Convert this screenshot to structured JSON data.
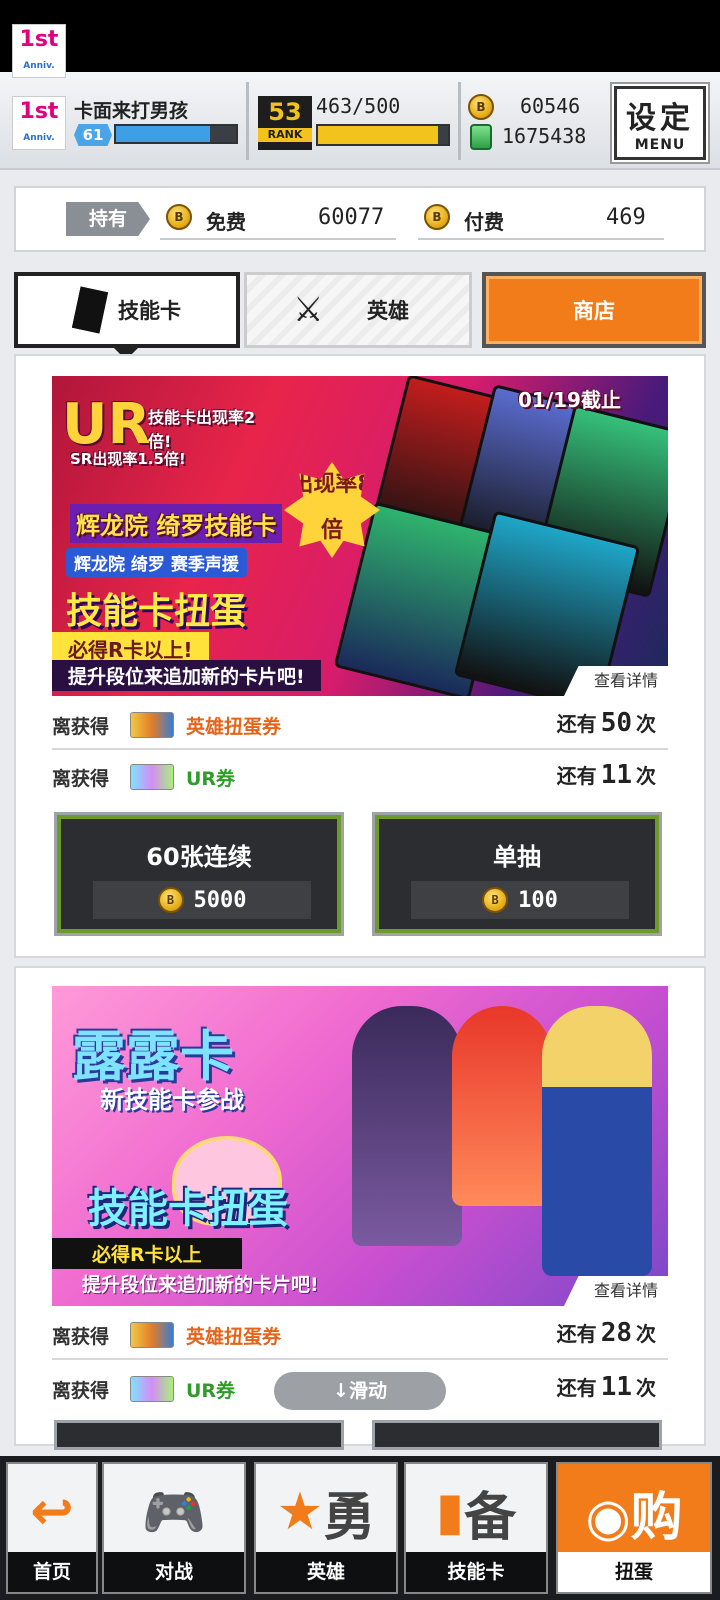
{
  "header": {
    "player_name": "卡面来打男孩",
    "level": "61",
    "level_progress": 0.78,
    "rank": "53",
    "rank_label": "RANK",
    "rank_exp": "463/500",
    "rank_progress": 0.926,
    "logo_text": "1st",
    "logo_sub": "Anniv.",
    "coins": "60546",
    "gems": "1675438",
    "settings_label": "设定",
    "menu_label": "MENU"
  },
  "owned": {
    "label": "持有",
    "free_label": "免费",
    "free_value": "60077",
    "paid_label": "付费",
    "paid_value": "469"
  },
  "tabs": [
    {
      "label": "技能卡"
    },
    {
      "label": "英雄"
    },
    {
      "label": "商店"
    }
  ],
  "gacha1": {
    "banner": {
      "ur_line": "技能卡出现率2倍!",
      "sr_line": "SR出现率1.5倍!",
      "deadline": "01/19截止",
      "rate_badge": "出现率8倍",
      "featured": "辉龙院 绮罗技能卡",
      "tags": "辉龙院 绮罗 赛季声援",
      "title": "技能卡扭蛋",
      "guarantee": "必得R卡以上!",
      "promo": "提升段位来追加新的卡片吧!",
      "detail": "查看详情"
    },
    "rows": [
      {
        "label": "离获得",
        "item": "英雄扭蛋券",
        "remain_prefix": "还有",
        "remain": "50",
        "remain_suffix": "次"
      },
      {
        "label": "离获得",
        "item": "UR券",
        "remain_prefix": "还有",
        "remain": "11",
        "remain_suffix": "次"
      }
    ],
    "buttons": [
      {
        "title": "60张连续",
        "cost": "5000"
      },
      {
        "title": "单抽",
        "cost": "100"
      }
    ]
  },
  "gacha2": {
    "banner": {
      "headline": "露露卡",
      "sub": "新技能卡参战",
      "title": "技能卡扭蛋",
      "guarantee": "必得R卡以上",
      "promo": "提升段位来追加新的卡片吧!",
      "detail": "查看详情"
    },
    "rows": [
      {
        "label": "离获得",
        "item": "英雄扭蛋券",
        "remain_prefix": "还有",
        "remain": "28",
        "remain_suffix": "次"
      },
      {
        "label": "离获得",
        "item": "UR券",
        "remain_prefix": "还有",
        "remain": "11",
        "remain_suffix": "次"
      }
    ],
    "scroll_hint": "↓滑动"
  },
  "nav": [
    {
      "label": "首页",
      "icon": "home-back-icon"
    },
    {
      "label": "对战",
      "icon": "gamepad-icon"
    },
    {
      "label": "英雄",
      "icon": "hero-icon"
    },
    {
      "label": "技能卡",
      "icon": "skill-card-icon"
    },
    {
      "label": "扭蛋",
      "icon": "gacha-icon"
    }
  ],
  "colors": {
    "accent": "#f27b1a",
    "coin": "#e2a80d",
    "level_bar": "#3d9fe6",
    "rank_bar": "#f2c31d"
  }
}
